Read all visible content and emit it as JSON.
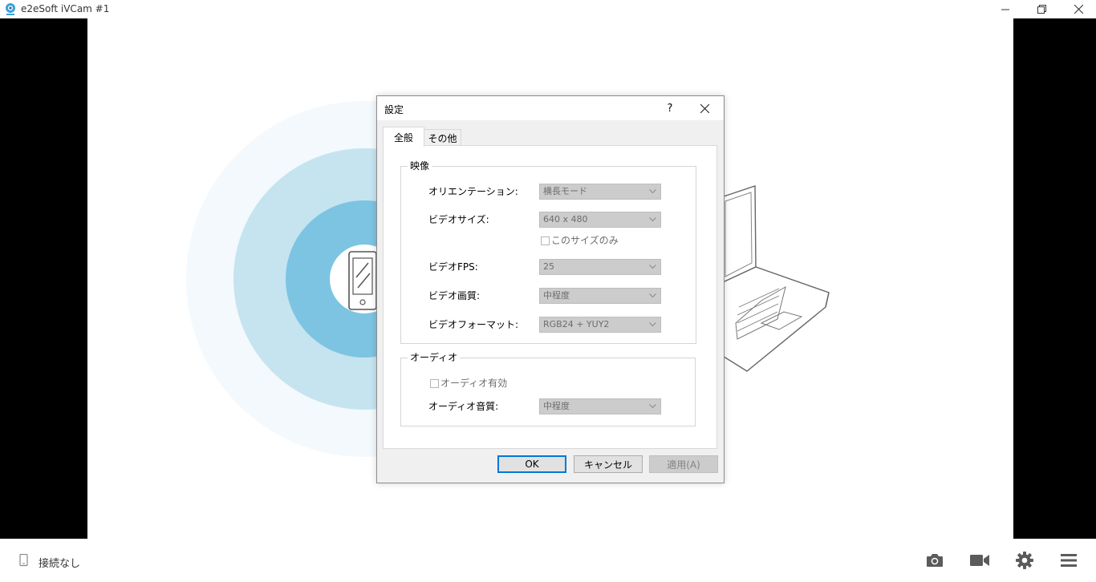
{
  "window": {
    "title": "e2eSoft iVCam #1",
    "controls": [
      "minimize-icon",
      "restore-icon",
      "close-icon"
    ]
  },
  "statusbar": {
    "connection_icon": "phone-icon",
    "connection_text": "接続なし",
    "buttons": [
      "camera-icon",
      "video-icon",
      "gear-icon",
      "menu-icon"
    ]
  },
  "dialog": {
    "title": "設定",
    "help_label": "?",
    "tabs": [
      {
        "label": "全般",
        "selected": true
      },
      {
        "label": "その他",
        "selected": false
      }
    ],
    "video_group": {
      "title": "映像",
      "orientation": {
        "label": "オリエンテーション:",
        "value": "横長モード"
      },
      "video_size": {
        "label": "ビデオサイズ:",
        "value": "640 x 480"
      },
      "size_only": {
        "label": "このサイズのみ",
        "checked": false
      },
      "video_fps": {
        "label": "ビデオFPS:",
        "value": "25"
      },
      "video_quality": {
        "label": "ビデオ画質:",
        "value": "中程度"
      },
      "video_format": {
        "label": "ビデオフォーマット:",
        "value": "RGB24 + YUY2"
      }
    },
    "audio_group": {
      "title": "オーディオ",
      "audio_enabled": {
        "label": "オーディオ有効",
        "checked": false
      },
      "audio_quality": {
        "label": "オーディオ音質:",
        "value": "中程度"
      }
    },
    "buttons": {
      "ok": "OK",
      "cancel": "キャンセル",
      "apply": "適用(A)"
    }
  },
  "colors": {
    "accent": "#0078d7",
    "ring_outer": "#f3f9fc",
    "ring_mid": "#c5e4f0",
    "ring_inner": "#7dc4e2",
    "background_bars": "#000000"
  }
}
